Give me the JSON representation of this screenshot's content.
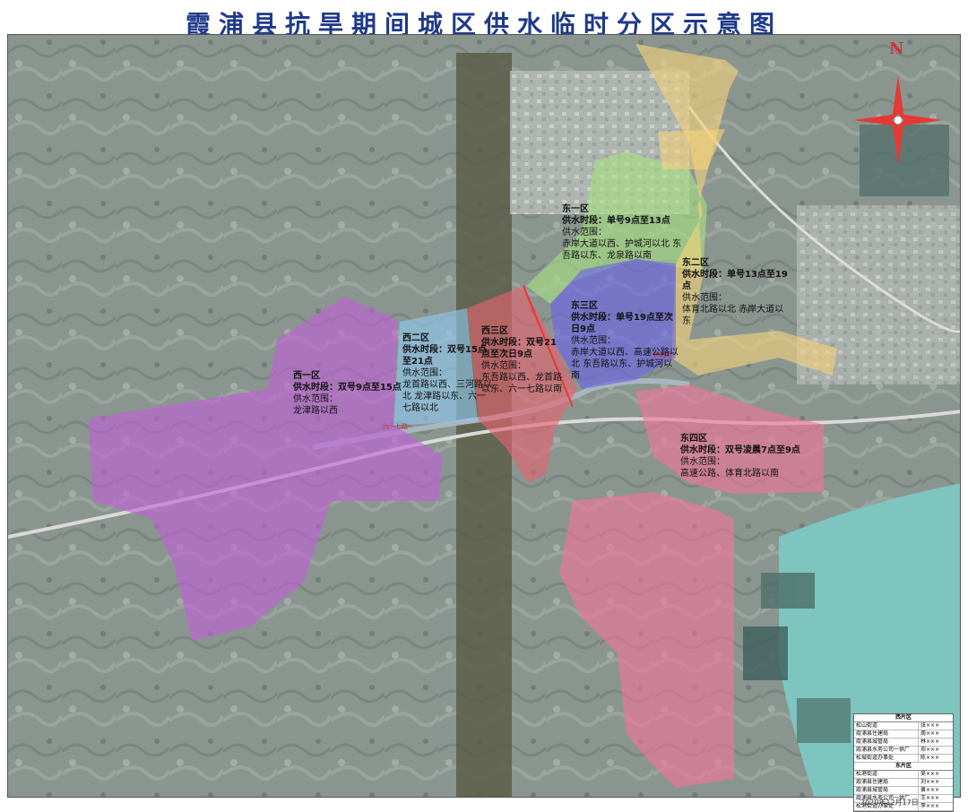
{
  "title": "霞浦县抗旱期间城区供水临时分区示意图",
  "compass": {
    "north_label": "N",
    "color": "#e53935",
    "icon": "compass-rose-icon"
  },
  "colors": {
    "west1": "#c15fd6",
    "west2": "#8fc8ef",
    "west3": "#e7626f",
    "east1": "#a6e07f",
    "east2": "#f4d27a",
    "east3": "#6c63e6",
    "east4": "#f2739a",
    "boundary": "#e53935"
  },
  "zones": {
    "west1": {
      "name": "西一区",
      "time": "供水时段：双号9点至15点",
      "range_title": "供水范围：",
      "range": "龙津路以西"
    },
    "west2": {
      "name": "西二区",
      "time": "供水时段：双号15点至21点",
      "range_title": "供水范围：",
      "range": "龙首路以西、三河路以北 龙津路以东、六一七路以北"
    },
    "west3": {
      "name": "西三区",
      "time": "供水时段：双号21点至次日9点",
      "range_title": "供水范围：",
      "range": "东吾路以西、龙首路以东、六一七路以南"
    },
    "east1": {
      "name": "东一区",
      "time": "供水时段：单号9点至13点",
      "range_title": "供水范围：",
      "range": "赤岸大道以西、护城河以北 东吾路以东、龙泉路以南"
    },
    "east2": {
      "name": "东二区",
      "time": "供水时段：单号13点至19点",
      "range_title": "供水范围：",
      "range": "体育北路以北 赤岸大道以东"
    },
    "east3": {
      "name": "东三区",
      "time": "供水时段：单号19点至次日9点",
      "range_title": "供水范围：",
      "range": "赤岸大道以西、高速公路以北 东吾路以东、护城河以南"
    },
    "east4": {
      "name": "东四区",
      "time": "供水时段：双号凌晨7点至9点",
      "range_title": "供水范围：",
      "range": "高速公路、体育北路以南"
    }
  },
  "legend": {
    "west_header": "西片区",
    "west_rows": [
      [
        "松山街道",
        "张×××"
      ],
      [
        "霞浦县住建局",
        "周×××"
      ],
      [
        "霞浦县城管局",
        "林×××"
      ],
      [
        "霞浦县水务公司一供厂",
        "郑×××"
      ],
      [
        "松城街道办事处",
        "陈×××"
      ]
    ],
    "east_header": "东片区",
    "east_rows": [
      [
        "松港街道",
        "吴×××"
      ],
      [
        "霞浦县住建局",
        "刘×××"
      ],
      [
        "霞浦县城管局",
        "黄×××"
      ],
      [
        "霞浦县水务公司一供厂",
        "王×××"
      ],
      [
        "松港街道办事处",
        "李×××"
      ]
    ]
  },
  "date": "2020年12月17日"
}
